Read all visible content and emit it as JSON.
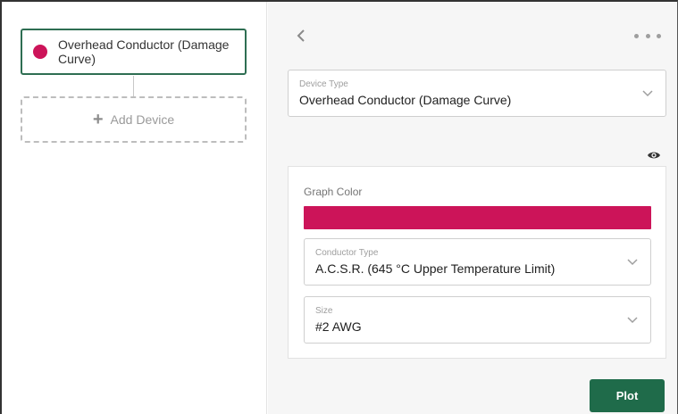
{
  "colors": {
    "accent_green": "#2e6e52",
    "graph_color": "#cc1459",
    "plot_button": "#1f6b4a"
  },
  "device_list": {
    "items": [
      {
        "label": "Overhead Conductor (Damage Curve)",
        "dot_color": "#cc1459"
      }
    ],
    "add_label": "Add Device"
  },
  "toolbar": {
    "back_icon": "chevron-left-icon",
    "more_icon": "more-horizontal-icon"
  },
  "device_type": {
    "caption": "Device Type",
    "value": "Overhead Conductor (Damage Curve)"
  },
  "settings": {
    "graph_color_label": "Graph Color",
    "conductor_type": {
      "caption": "Conductor Type",
      "value": "A.C.S.R. (645 °C Upper Temperature Limit)"
    },
    "size": {
      "caption": "Size",
      "value": "#2 AWG"
    }
  },
  "actions": {
    "plot_label": "Plot"
  }
}
